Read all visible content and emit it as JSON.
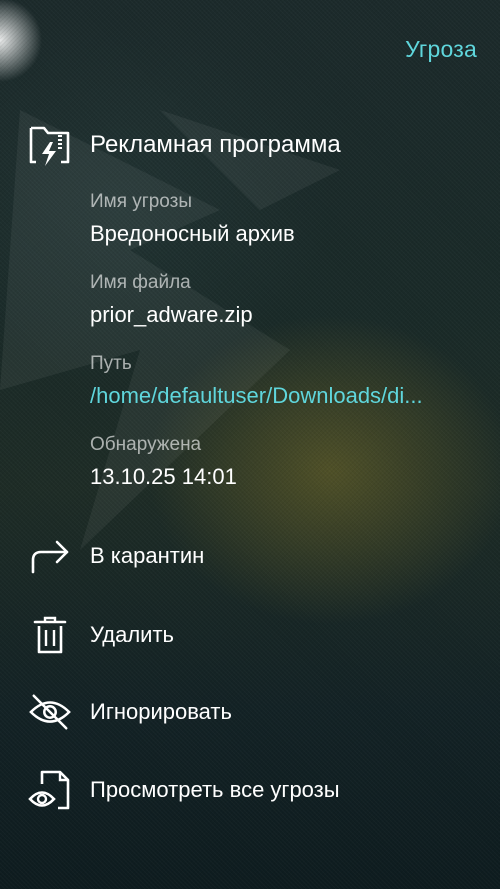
{
  "header": {
    "title": "Угроза"
  },
  "threat": {
    "type": "Рекламная программа",
    "icon": "folder-lightning-icon"
  },
  "fields": [
    {
      "label": "Имя угрозы",
      "value": "Вредоносный архив"
    },
    {
      "label": "Имя файла",
      "value": "prior_adware.zip"
    },
    {
      "label": "Путь",
      "value": "/home/defaultuser/Downloads/di..."
    },
    {
      "label": "Обнаружена",
      "value": "13.10.25 14:01"
    }
  ],
  "actions": [
    {
      "label": "В карантин",
      "icon": "share-arrow-icon"
    },
    {
      "label": "Удалить",
      "icon": "trash-icon"
    },
    {
      "label": "Игнорировать",
      "icon": "eye-off-icon"
    },
    {
      "label": "Просмотреть все угрозы",
      "icon": "document-eye-icon"
    }
  ],
  "colors": {
    "accent": "#5fd6dc",
    "text": "#ffffff"
  }
}
